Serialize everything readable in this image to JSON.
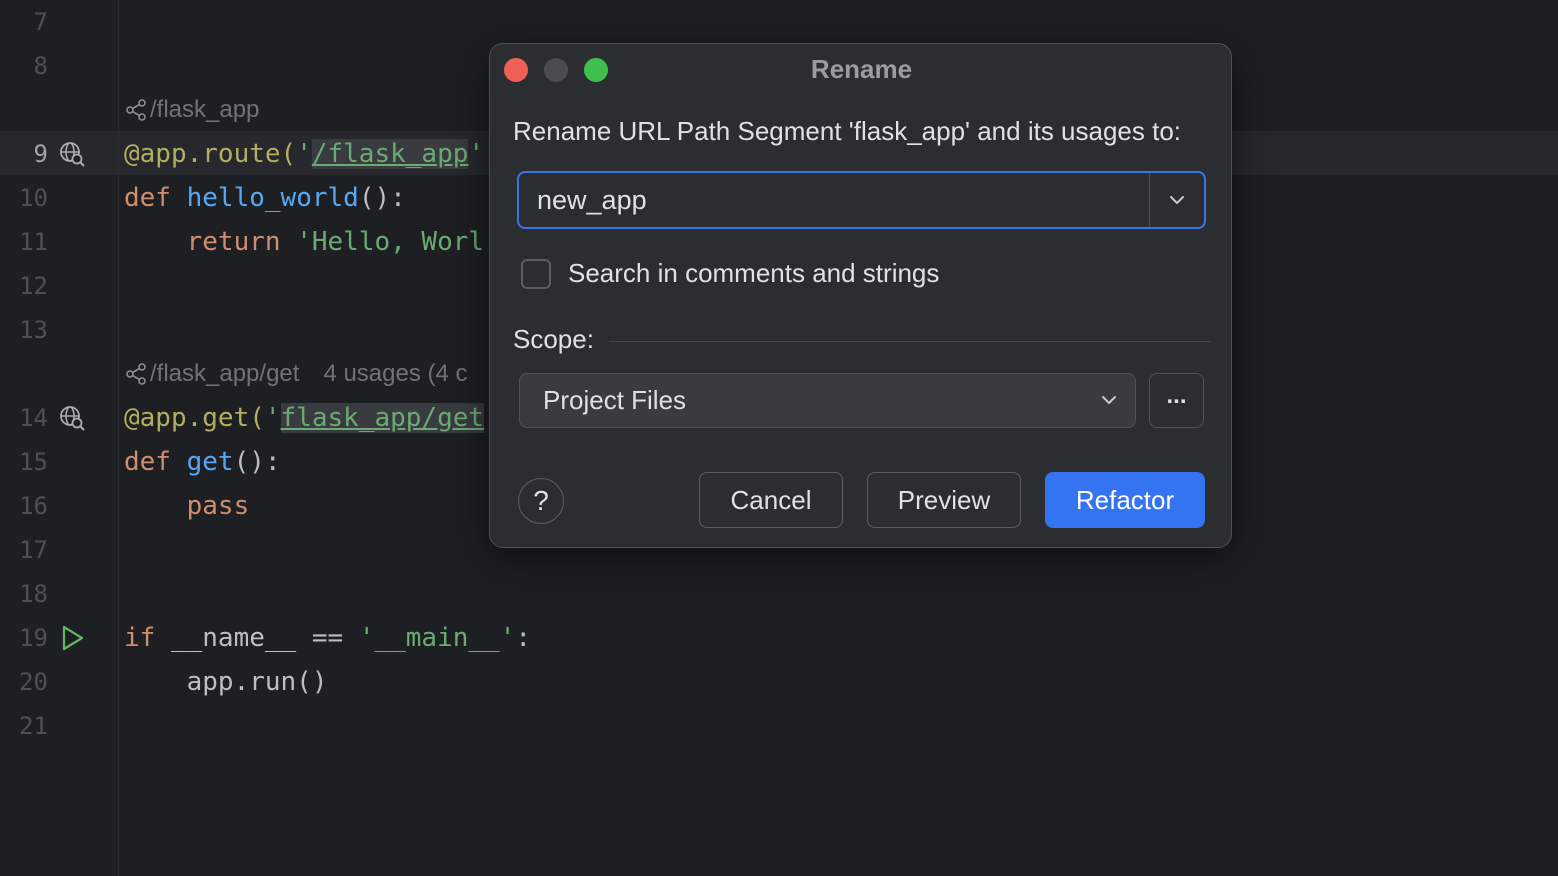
{
  "editor": {
    "lines": [
      {
        "num": "7",
        "tokens": []
      },
      {
        "num": "8",
        "tokens": []
      },
      {
        "num": "9",
        "current": true,
        "icon": "web-endpoint-icon",
        "tokens": [
          {
            "t": "@app.route(",
            "c": "dec"
          },
          {
            "t": "'",
            "c": "str"
          },
          {
            "t": "/flask_app",
            "c": "str url urlbg"
          },
          {
            "t": "'",
            "c": "str"
          }
        ]
      },
      {
        "num": "10",
        "tokens": [
          {
            "t": "def ",
            "c": "kw"
          },
          {
            "t": "hello_world",
            "c": "fn"
          },
          {
            "t": "():",
            "c": ""
          }
        ]
      },
      {
        "num": "11",
        "tokens": [
          {
            "t": "    return ",
            "c": "kw"
          },
          {
            "t": "'Hello, Worl",
            "c": "str"
          }
        ]
      },
      {
        "num": "12",
        "tokens": []
      },
      {
        "num": "13",
        "tokens": []
      },
      {
        "num": "14",
        "icon": "web-endpoint-icon",
        "tokens": [
          {
            "t": "@app.get(",
            "c": "dec"
          },
          {
            "t": "'",
            "c": "str"
          },
          {
            "t": "flask_app/get",
            "c": "str url urlbg"
          }
        ]
      },
      {
        "num": "15",
        "tokens": [
          {
            "t": "def ",
            "c": "kw"
          },
          {
            "t": "get",
            "c": "fn"
          },
          {
            "t": "():",
            "c": ""
          }
        ]
      },
      {
        "num": "16",
        "tokens": [
          {
            "t": "    pass",
            "c": "kw"
          }
        ]
      },
      {
        "num": "17",
        "tokens": []
      },
      {
        "num": "18",
        "tokens": []
      },
      {
        "num": "19",
        "icon": "run-icon",
        "tokens": [
          {
            "t": "if ",
            "c": "kw"
          },
          {
            "t": "__name__ == ",
            "c": ""
          },
          {
            "t": "'__main__'",
            "c": "str"
          },
          {
            "t": ":",
            "c": ""
          }
        ]
      },
      {
        "num": "20",
        "tokens": [
          {
            "t": "    app.run()",
            "c": ""
          }
        ]
      },
      {
        "num": "21",
        "tokens": []
      }
    ],
    "hints": [
      {
        "after": "8",
        "path": "/flask_app",
        "usages": ""
      },
      {
        "after": "13",
        "path": "/flask_app/get",
        "usages": "4 usages (4 c"
      }
    ]
  },
  "dialog": {
    "title": "Rename",
    "prompt": "Rename URL Path Segment 'flask_app' and its usages to:",
    "name_value": "new_app",
    "search_comments_label": "Search in comments and strings",
    "search_comments_checked": false,
    "scope_label": "Scope:",
    "scope_value": "Project Files",
    "more_label": "...",
    "help_label": "?",
    "cancel_label": "Cancel",
    "preview_label": "Preview",
    "refactor_label": "Refactor"
  },
  "colors": {
    "background": "#1e1f22",
    "dialog": "#2b2d30",
    "accent": "#3574f0"
  }
}
